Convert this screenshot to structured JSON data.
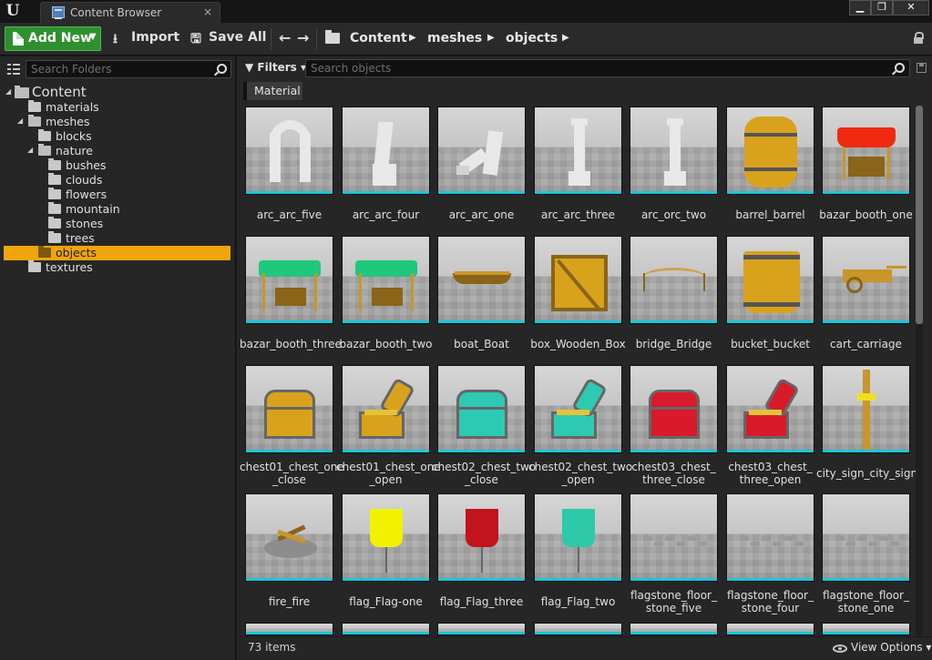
{
  "window": {
    "tab_title": "Content Browser",
    "tab_close": "×",
    "controls": {
      "minimize": "▁",
      "maximize": "❐",
      "close": "✕"
    }
  },
  "toolbar": {
    "add_new_label": "Add New",
    "import_label": "Import",
    "save_all_label": "Save All",
    "back_glyph": "←",
    "forward_glyph": "→",
    "breadcrumb": [
      "Content",
      "meshes",
      "objects"
    ],
    "crumb_arrow": "▶"
  },
  "sidebar": {
    "search_placeholder": "Search Folders",
    "tree": [
      {
        "label": "Content",
        "depth": 0,
        "toggle": "◢",
        "selected": false
      },
      {
        "label": "materials",
        "depth": 1,
        "toggle": "",
        "selected": false
      },
      {
        "label": "meshes",
        "depth": 1,
        "toggle": "◢",
        "selected": false
      },
      {
        "label": "blocks",
        "depth": 2,
        "toggle": "",
        "selected": false
      },
      {
        "label": "nature",
        "depth": 2,
        "toggle": "◢",
        "selected": false
      },
      {
        "label": "bushes",
        "depth": 3,
        "toggle": "",
        "selected": false
      },
      {
        "label": "clouds",
        "depth": 3,
        "toggle": "",
        "selected": false
      },
      {
        "label": "flowers",
        "depth": 3,
        "toggle": "",
        "selected": false
      },
      {
        "label": "mountain",
        "depth": 3,
        "toggle": "",
        "selected": false
      },
      {
        "label": "stones",
        "depth": 3,
        "toggle": "",
        "selected": false
      },
      {
        "label": "trees",
        "depth": 3,
        "toggle": "",
        "selected": false
      },
      {
        "label": "objects",
        "depth": 2,
        "toggle": "",
        "selected": true
      },
      {
        "label": "textures",
        "depth": 1,
        "toggle": "",
        "selected": false
      }
    ]
  },
  "content": {
    "filters_label": "Filters",
    "filters_caret": "▾",
    "search_placeholder": "Search objects",
    "active_filter": "Material",
    "assets": [
      {
        "name": "arc_arc_five",
        "icon": "stone-arch"
      },
      {
        "name": "arc_arc_four",
        "icon": "stone-pillar-broken"
      },
      {
        "name": "arc_arc_one",
        "icon": "stone-rubble"
      },
      {
        "name": "arc_arc_three",
        "icon": "stone-pillar"
      },
      {
        "name": "arc_orc_two",
        "icon": "stone-pillar"
      },
      {
        "name": "barrel_barrel",
        "icon": "barrel"
      },
      {
        "name": "bazar_booth_one",
        "icon": "booth-red"
      },
      {
        "name": "bazar_booth_three",
        "icon": "booth-green"
      },
      {
        "name": "bazar_booth_two",
        "icon": "booth-green"
      },
      {
        "name": "boat_Boat",
        "icon": "boat"
      },
      {
        "name": "box_Wooden_Box",
        "icon": "crate"
      },
      {
        "name": "bridge_Bridge",
        "icon": "bridge"
      },
      {
        "name": "bucket_bucket",
        "icon": "bucket"
      },
      {
        "name": "cart_carriage",
        "icon": "cart"
      },
      {
        "name": "chest01_chest_one_close",
        "icon": "chest-gold-closed"
      },
      {
        "name": "chest01_chest_one_open",
        "icon": "chest-gold-open"
      },
      {
        "name": "chest02_chest_two_close",
        "icon": "chest-teal-closed"
      },
      {
        "name": "chest02_chest_two_open",
        "icon": "chest-teal-open"
      },
      {
        "name": "chest03_chest_three_close",
        "icon": "chest-red-closed"
      },
      {
        "name": "chest03_chest_three_open",
        "icon": "chest-red-open"
      },
      {
        "name": "city_sign_city_sign",
        "icon": "signpost"
      },
      {
        "name": "fire_fire",
        "icon": "campfire"
      },
      {
        "name": "flag_Flag-one",
        "icon": "flag-yellow"
      },
      {
        "name": "flag_Flag_three",
        "icon": "flag-red"
      },
      {
        "name": "flag_Flag_two",
        "icon": "flag-teal"
      },
      {
        "name": "flagstone_floor_stone_five",
        "icon": "flagstones"
      },
      {
        "name": "flagstone_floor_stone_four",
        "icon": "flagstones"
      },
      {
        "name": "flagstone_floor_stone_one",
        "icon": "flagstones"
      }
    ],
    "item_count": "73 items",
    "view_options_label": "View Options",
    "view_options_caret": "▾"
  },
  "colors": {
    "accent_selected": "#f0a50c",
    "add_new_green": "#2f8f2f",
    "thumbnail_underline": "#19c6d6"
  }
}
